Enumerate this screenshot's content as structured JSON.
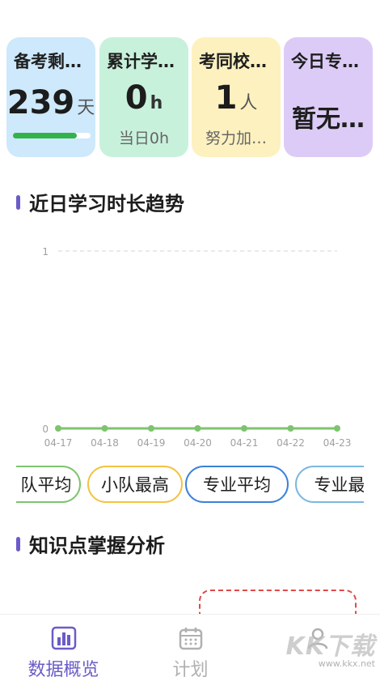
{
  "stats": [
    {
      "title": "备考剩…",
      "value": "239",
      "unit": "天",
      "progress": 0.82
    },
    {
      "title": "累计学…",
      "value": "0",
      "unit": "h",
      "sub": "当日0h"
    },
    {
      "title": "考同校…",
      "value": "1",
      "unit": "人",
      "sub": "努力加…"
    },
    {
      "title": "今日专…",
      "text": "暂无…"
    }
  ],
  "trend": {
    "title": "近日学习时长趋势"
  },
  "chart_data": {
    "type": "line",
    "x": [
      "04-17",
      "04-18",
      "04-19",
      "04-20",
      "04-21",
      "04-22",
      "04-23"
    ],
    "series": [
      {
        "values": [
          0,
          0,
          0,
          0,
          0,
          0,
          0
        ]
      }
    ],
    "yticks": [
      "0",
      "1"
    ],
    "ylim": [
      0,
      1
    ],
    "grid": true,
    "colors": {
      "line": "#7dc46e",
      "grid": "#e4e4e4",
      "tick": "#a0a0a0"
    }
  },
  "pills": [
    {
      "label": "队平均",
      "color": "#7dc46e"
    },
    {
      "label": "小队最高",
      "color": "#f3c340"
    },
    {
      "label": "专业平均",
      "color": "#3b82d6"
    },
    {
      "label": "专业最",
      "color": "#7ab7e0"
    }
  ],
  "knowledge": {
    "title": "知识点掌握分析"
  },
  "nav": [
    {
      "label": "数据概览",
      "icon": "bar-chart-icon",
      "color": "#6a5cc8"
    },
    {
      "label": "计划",
      "icon": "calendar-icon",
      "color": "#b0b0b0"
    },
    {
      "label": "",
      "icon": "person-icon",
      "color": "#b0b0b0"
    }
  ],
  "watermark": {
    "main": "KK下载",
    "sub": "www.kkx.net"
  }
}
